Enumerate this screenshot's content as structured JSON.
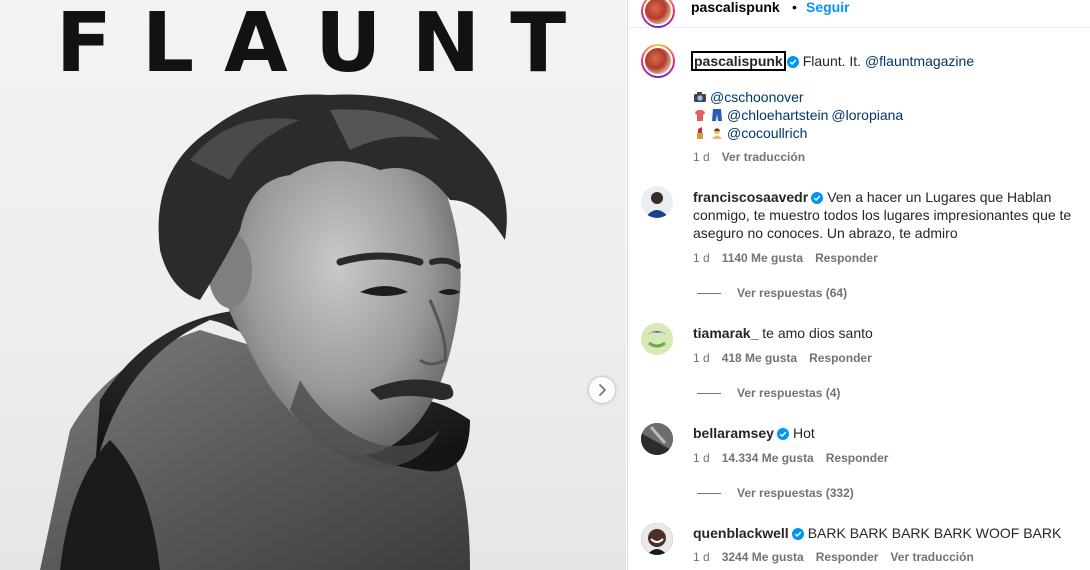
{
  "post": {
    "magazine_title": "FLAUNT",
    "next_label": "›"
  },
  "header": {
    "username": "pascalispunk",
    "separator": "•",
    "follow_label": "Seguir"
  },
  "caption": {
    "username": "pascalispunk",
    "text": "Flaunt. It.",
    "mention": "@flauntmagazine",
    "credits": [
      {
        "icon": "camera-emoji",
        "mentions": [
          "@cschoonover"
        ]
      },
      {
        "icon": "shirt-jeans-emoji",
        "mentions": [
          "@chloehartstein",
          "@loropiana"
        ]
      },
      {
        "icon": "lipstick-person-emoji",
        "mentions": [
          "@cocoullrich"
        ]
      }
    ],
    "time": "1 d",
    "translate_label": "Ver traducción"
  },
  "comments": [
    {
      "username": "franciscosaavedr",
      "text": "Ven a hacer un Lugares que Hablan conmigo, te muestro todos los lugares impresionantes que te aseguro no conoces. Un abrazo, te admiro",
      "time": "1 d",
      "likes": "1140 Me gusta",
      "reply_label": "Responder",
      "view_replies": "Ver respuestas (64)"
    },
    {
      "username": "tiamarak_",
      "text": "te amo dios santo",
      "time": "1 d",
      "likes": "418 Me gusta",
      "reply_label": "Responder",
      "view_replies": "Ver respuestas (4)"
    },
    {
      "username": "bellaramsey",
      "text": "Hot",
      "time": "1 d",
      "likes": "14.334 Me gusta",
      "reply_label": "Responder",
      "view_replies": "Ver respuestas (332)"
    },
    {
      "username": "quenblackwell",
      "text": "BARK BARK BARK BARK WOOF BARK",
      "time": "1 d",
      "likes": "3244 Me gusta",
      "reply_label": "Responder",
      "translate_label": "Ver traducción"
    }
  ],
  "colors": {
    "link_blue": "#0095f6",
    "mention_blue": "#00376b",
    "meta_gray": "#737373",
    "verified_blue": "#0095f6"
  }
}
